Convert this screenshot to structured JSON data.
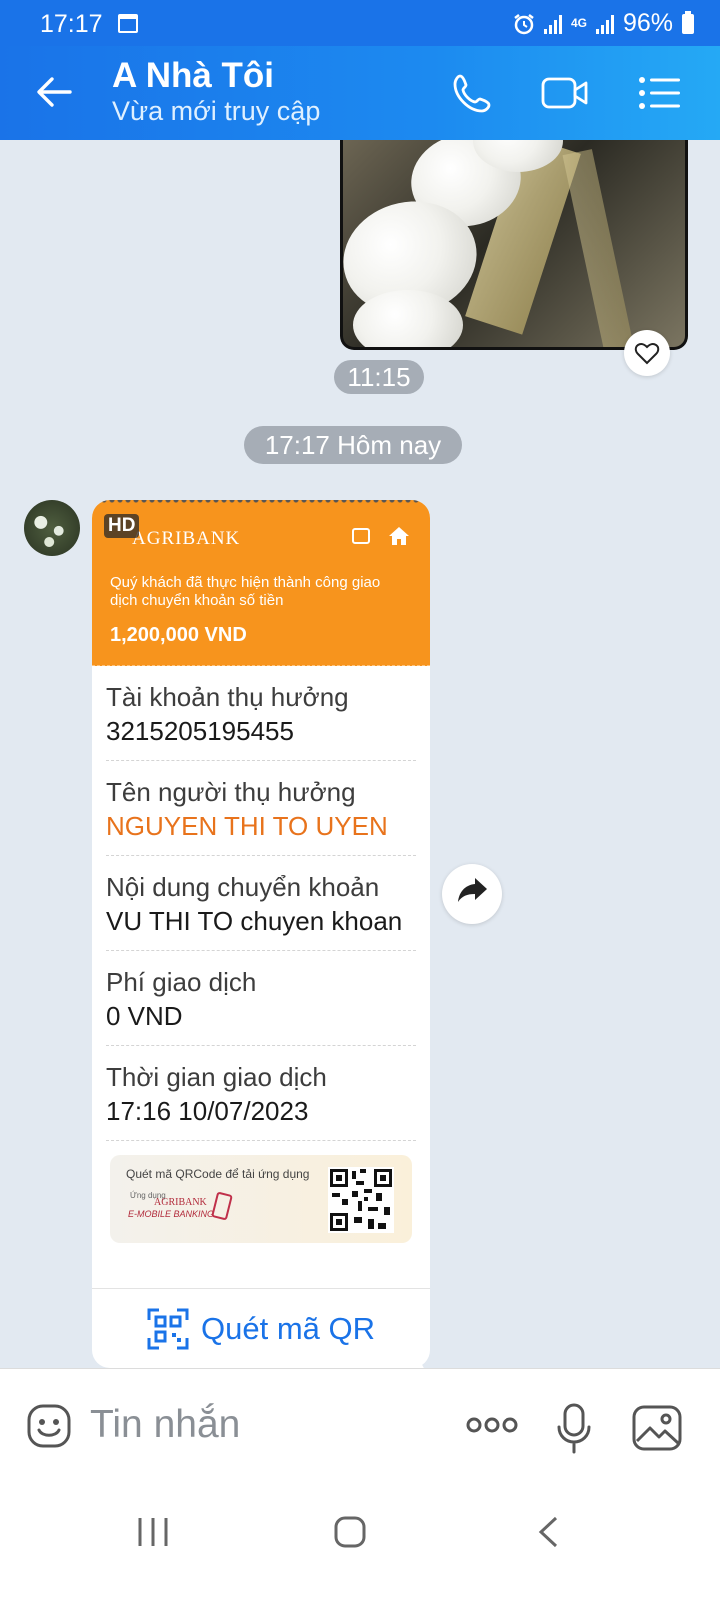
{
  "status_bar": {
    "time": "17:17",
    "network": "4G",
    "battery": "96%"
  },
  "header": {
    "contact_name": "A Nhà Tôi",
    "presence": "Vừa mới truy cập"
  },
  "messages": {
    "photo_time": "11:15",
    "day_divider": "17:17 Hôm nay"
  },
  "receipt": {
    "hd_badge": "HD",
    "bank_name": "AGRIBANK",
    "notice": "Quý khách đã thực hiện thành công giao dịch chuyển khoản số tiền",
    "amount": "1,200,000 VND",
    "fields": [
      {
        "label": "Tài khoản thụ hưởng",
        "value": "3215205195455"
      },
      {
        "label": "Tên người thụ hưởng",
        "value": "NGUYEN THI TO UYEN"
      },
      {
        "label": "Nội dung chuyển khoản",
        "value": "VU THI TO chuyen khoan"
      },
      {
        "label": "Phí giao dịch",
        "value": "0 VND"
      },
      {
        "label": "Thời gian giao dịch",
        "value": "17:16 10/07/2023"
      }
    ],
    "promo": {
      "text": "Quét mã QRCode để tải ứng dụng",
      "app_prefix": "Ứng dụng",
      "app_bank": "AGRIBANK",
      "app_name": "E-MOBILE BANKING"
    },
    "qr_button": "Quét mã QR"
  },
  "composer": {
    "placeholder": "Tin nhắn"
  },
  "colors": {
    "primary": "#1a73e8",
    "agribank_orange": "#f7941d",
    "payee_orange": "#e8731c"
  }
}
